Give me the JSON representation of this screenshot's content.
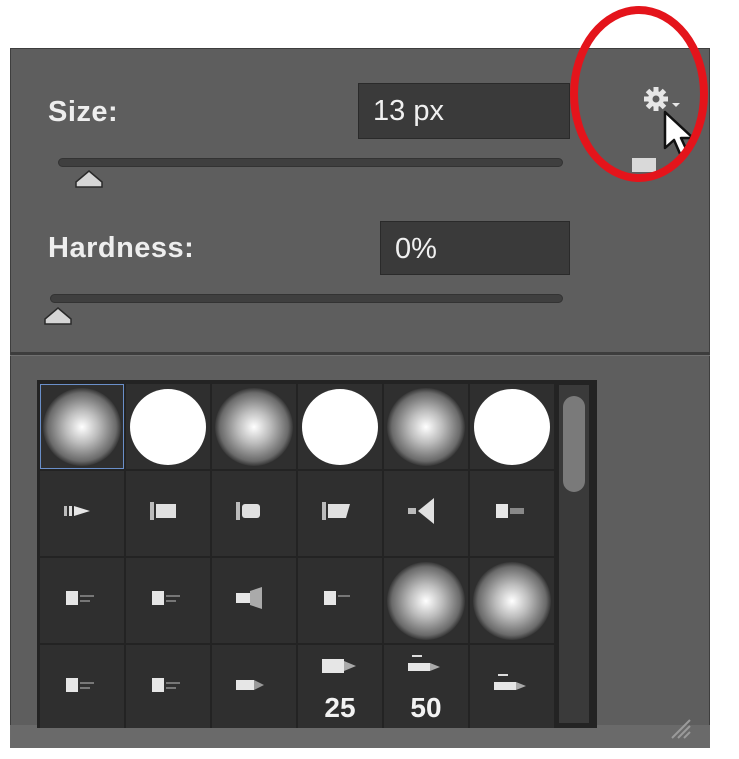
{
  "size": {
    "label": "Size:",
    "value": "13 px",
    "slider_fraction": 0.06
  },
  "hardness": {
    "label": "Hardness:",
    "value": "0%",
    "slider_fraction": 0.0
  },
  "settings": {
    "icon": "gear-icon"
  },
  "brushes": [
    {
      "kind": "soft"
    },
    {
      "kind": "hard"
    },
    {
      "kind": "soft"
    },
    {
      "kind": "hard"
    },
    {
      "kind": "soft"
    },
    {
      "kind": "hard"
    },
    {
      "kind": "tip",
      "variant": "a"
    },
    {
      "kind": "tip",
      "variant": "b"
    },
    {
      "kind": "tip",
      "variant": "c"
    },
    {
      "kind": "tip",
      "variant": "d"
    },
    {
      "kind": "tip",
      "variant": "fan"
    },
    {
      "kind": "tip",
      "variant": "e"
    },
    {
      "kind": "tip",
      "variant": "f"
    },
    {
      "kind": "tip",
      "variant": "f"
    },
    {
      "kind": "tip",
      "variant": "g"
    },
    {
      "kind": "tip",
      "variant": "h"
    },
    {
      "kind": "soft"
    },
    {
      "kind": "soft"
    },
    {
      "kind": "tip",
      "variant": "f"
    },
    {
      "kind": "tip",
      "variant": "f"
    },
    {
      "kind": "tip",
      "variant": "i"
    },
    {
      "kind": "tip",
      "variant": "j",
      "label": "25"
    },
    {
      "kind": "tip",
      "variant": "k",
      "label": "50"
    },
    {
      "kind": "tip",
      "variant": "k"
    }
  ],
  "colors": {
    "accent": "#6a8fc9",
    "highlight": "#e4141b"
  }
}
